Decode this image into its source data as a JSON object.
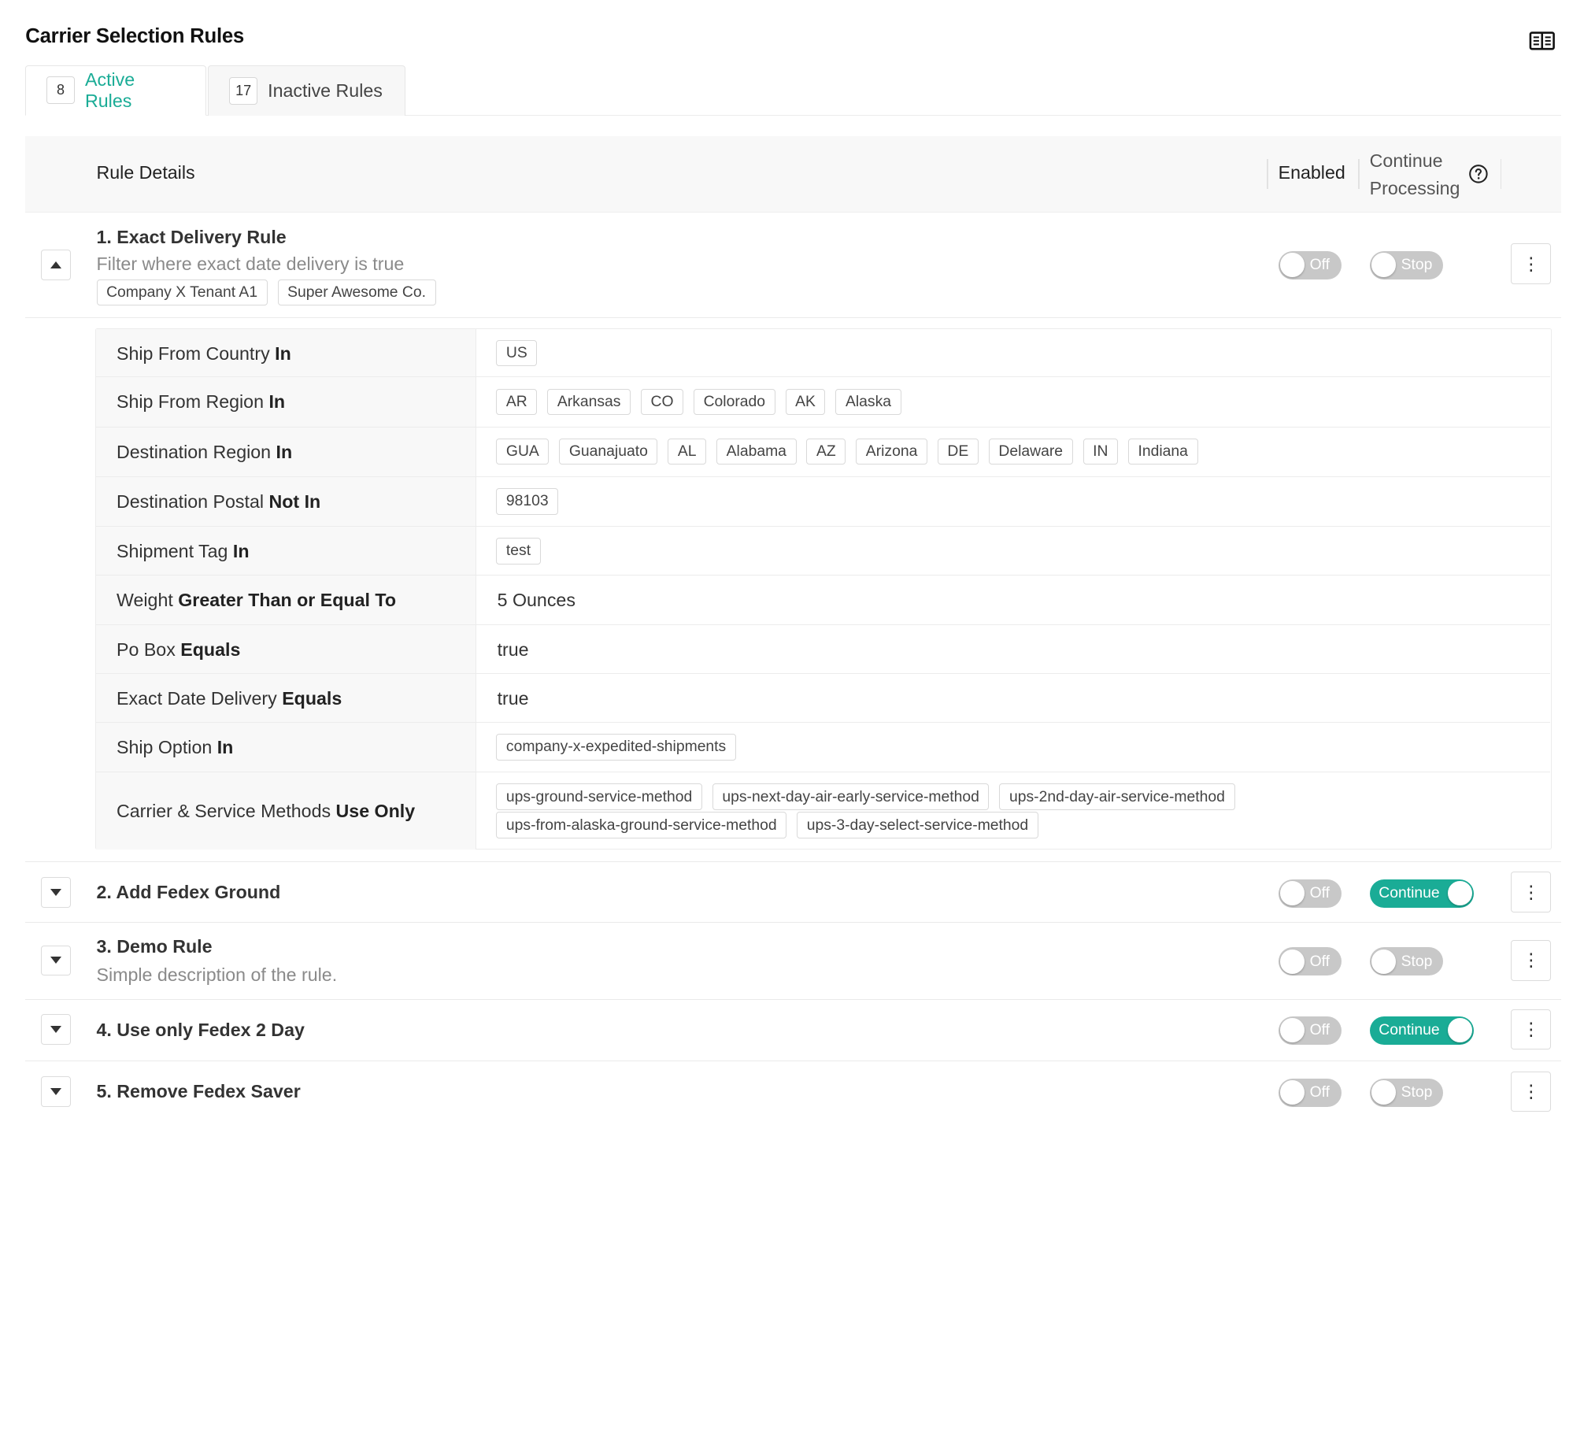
{
  "page": {
    "title": "Carrier Selection Rules",
    "docs_icon": "book-icon"
  },
  "tabs": [
    {
      "count": "8",
      "label": "Active Rules",
      "active": true
    },
    {
      "count": "17",
      "label": "Inactive Rules",
      "active": false
    }
  ],
  "table": {
    "col_details": "Rule Details",
    "col_enabled": "Enabled",
    "col_continue_1": "Continue",
    "col_continue_2": "Processing",
    "help_icon": "question-circle-icon"
  },
  "rules": [
    {
      "name": "1. Exact Delivery Rule",
      "description": "Filter where exact date delivery is true",
      "tenants": [
        "Company X Tenant A1",
        "Super Awesome Co."
      ],
      "expanded": true,
      "enabled_label": "Off",
      "enabled": false,
      "continue_label": "Stop",
      "continue": false
    },
    {
      "name": "2. Add Fedex Ground",
      "description": "",
      "expanded": false,
      "enabled_label": "Off",
      "enabled": false,
      "continue_label": "Continue",
      "continue": true
    },
    {
      "name": "3. Demo Rule",
      "description": "Simple description of the rule.",
      "expanded": false,
      "enabled_label": "Off",
      "enabled": false,
      "continue_label": "Stop",
      "continue": false
    },
    {
      "name": "4. Use only Fedex 2 Day",
      "description": "",
      "expanded": false,
      "enabled_label": "Off",
      "enabled": false,
      "continue_label": "Continue",
      "continue": true
    },
    {
      "name": "5. Remove Fedex Saver",
      "description": "",
      "expanded": false,
      "enabled_label": "Off",
      "enabled": false,
      "continue_label": "Stop",
      "continue": false
    }
  ],
  "conditions": [
    {
      "field": "Ship From Country",
      "op": "In",
      "tags": [
        "US"
      ]
    },
    {
      "field": "Ship From Region",
      "op": "In",
      "tags": [
        "AR",
        "Arkansas",
        "CO",
        "Colorado",
        "AK",
        "Alaska"
      ]
    },
    {
      "field": "Destination Region",
      "op": "In",
      "tags": [
        "GUA",
        "Guanajuato",
        "AL",
        "Alabama",
        "AZ",
        "Arizona",
        "DE",
        "Delaware",
        "IN",
        "Indiana"
      ]
    },
    {
      "field": "Destination Postal",
      "op": "Not In",
      "tags": [
        "98103"
      ]
    },
    {
      "field": "Shipment Tag",
      "op": "In",
      "tags": [
        "test"
      ]
    },
    {
      "field": "Weight",
      "op": "Greater Than or Equal To",
      "value": "5 Ounces"
    },
    {
      "field": "Po Box",
      "op": "Equals",
      "value": "true"
    },
    {
      "field": "Exact Date Delivery",
      "op": "Equals",
      "value": "true"
    },
    {
      "field": "Ship Option",
      "op": "In",
      "tags": [
        "company-x-expedited-shipments"
      ]
    },
    {
      "field": "Carrier & Service Methods",
      "op": "Use Only",
      "tags": [
        "ups-ground-service-method",
        "ups-next-day-air-early-service-method",
        "ups-2nd-day-air-service-method",
        "ups-from-alaska-ground-service-method",
        "ups-3-day-select-service-method"
      ]
    }
  ],
  "colors": {
    "accent": "#1aac96",
    "toggle_off": "#c8c8c8"
  }
}
